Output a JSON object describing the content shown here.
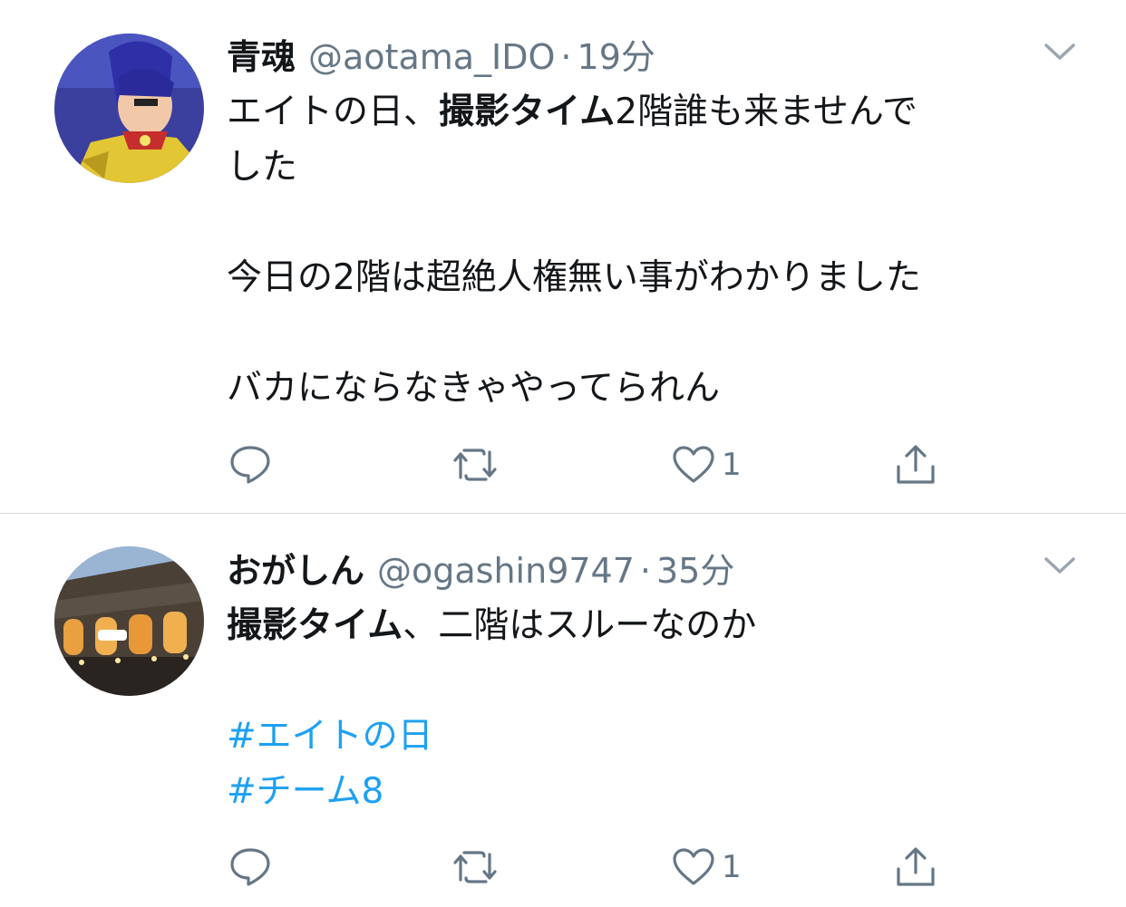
{
  "tweets": [
    {
      "name": "青魂",
      "handle": "@aotama_IDO",
      "separator": "·",
      "time": "19分",
      "lines": [
        [
          "エイトの日、",
          "撮影タイム",
          "2階誰も来ませんで"
        ],
        "した",
        "",
        "今日の2階は超絶人権無い事がわかりました",
        "",
        "バカにならなきゃやってられん"
      ],
      "reply_count": "",
      "retweet_count": "",
      "like_count": "1"
    },
    {
      "name": "おがしん",
      "handle": "@ogashin9747",
      "separator": "·",
      "time": "35分",
      "lines": [
        [
          "撮影タイム",
          "、二階はスルーなのか"
        ],
        "",
        "#エイトの日",
        "#チーム8"
      ],
      "reply_count": "",
      "retweet_count": "",
      "like_count": "1"
    }
  ],
  "icons": {
    "caret": "chevron-down-icon",
    "reply": "reply-icon",
    "retweet": "retweet-icon",
    "like": "heart-icon",
    "share": "share-icon"
  },
  "colors": {
    "text": "#14171a",
    "secondary": "#657786",
    "hashtag": "#1da1f2",
    "divider": "#d8dde2"
  }
}
